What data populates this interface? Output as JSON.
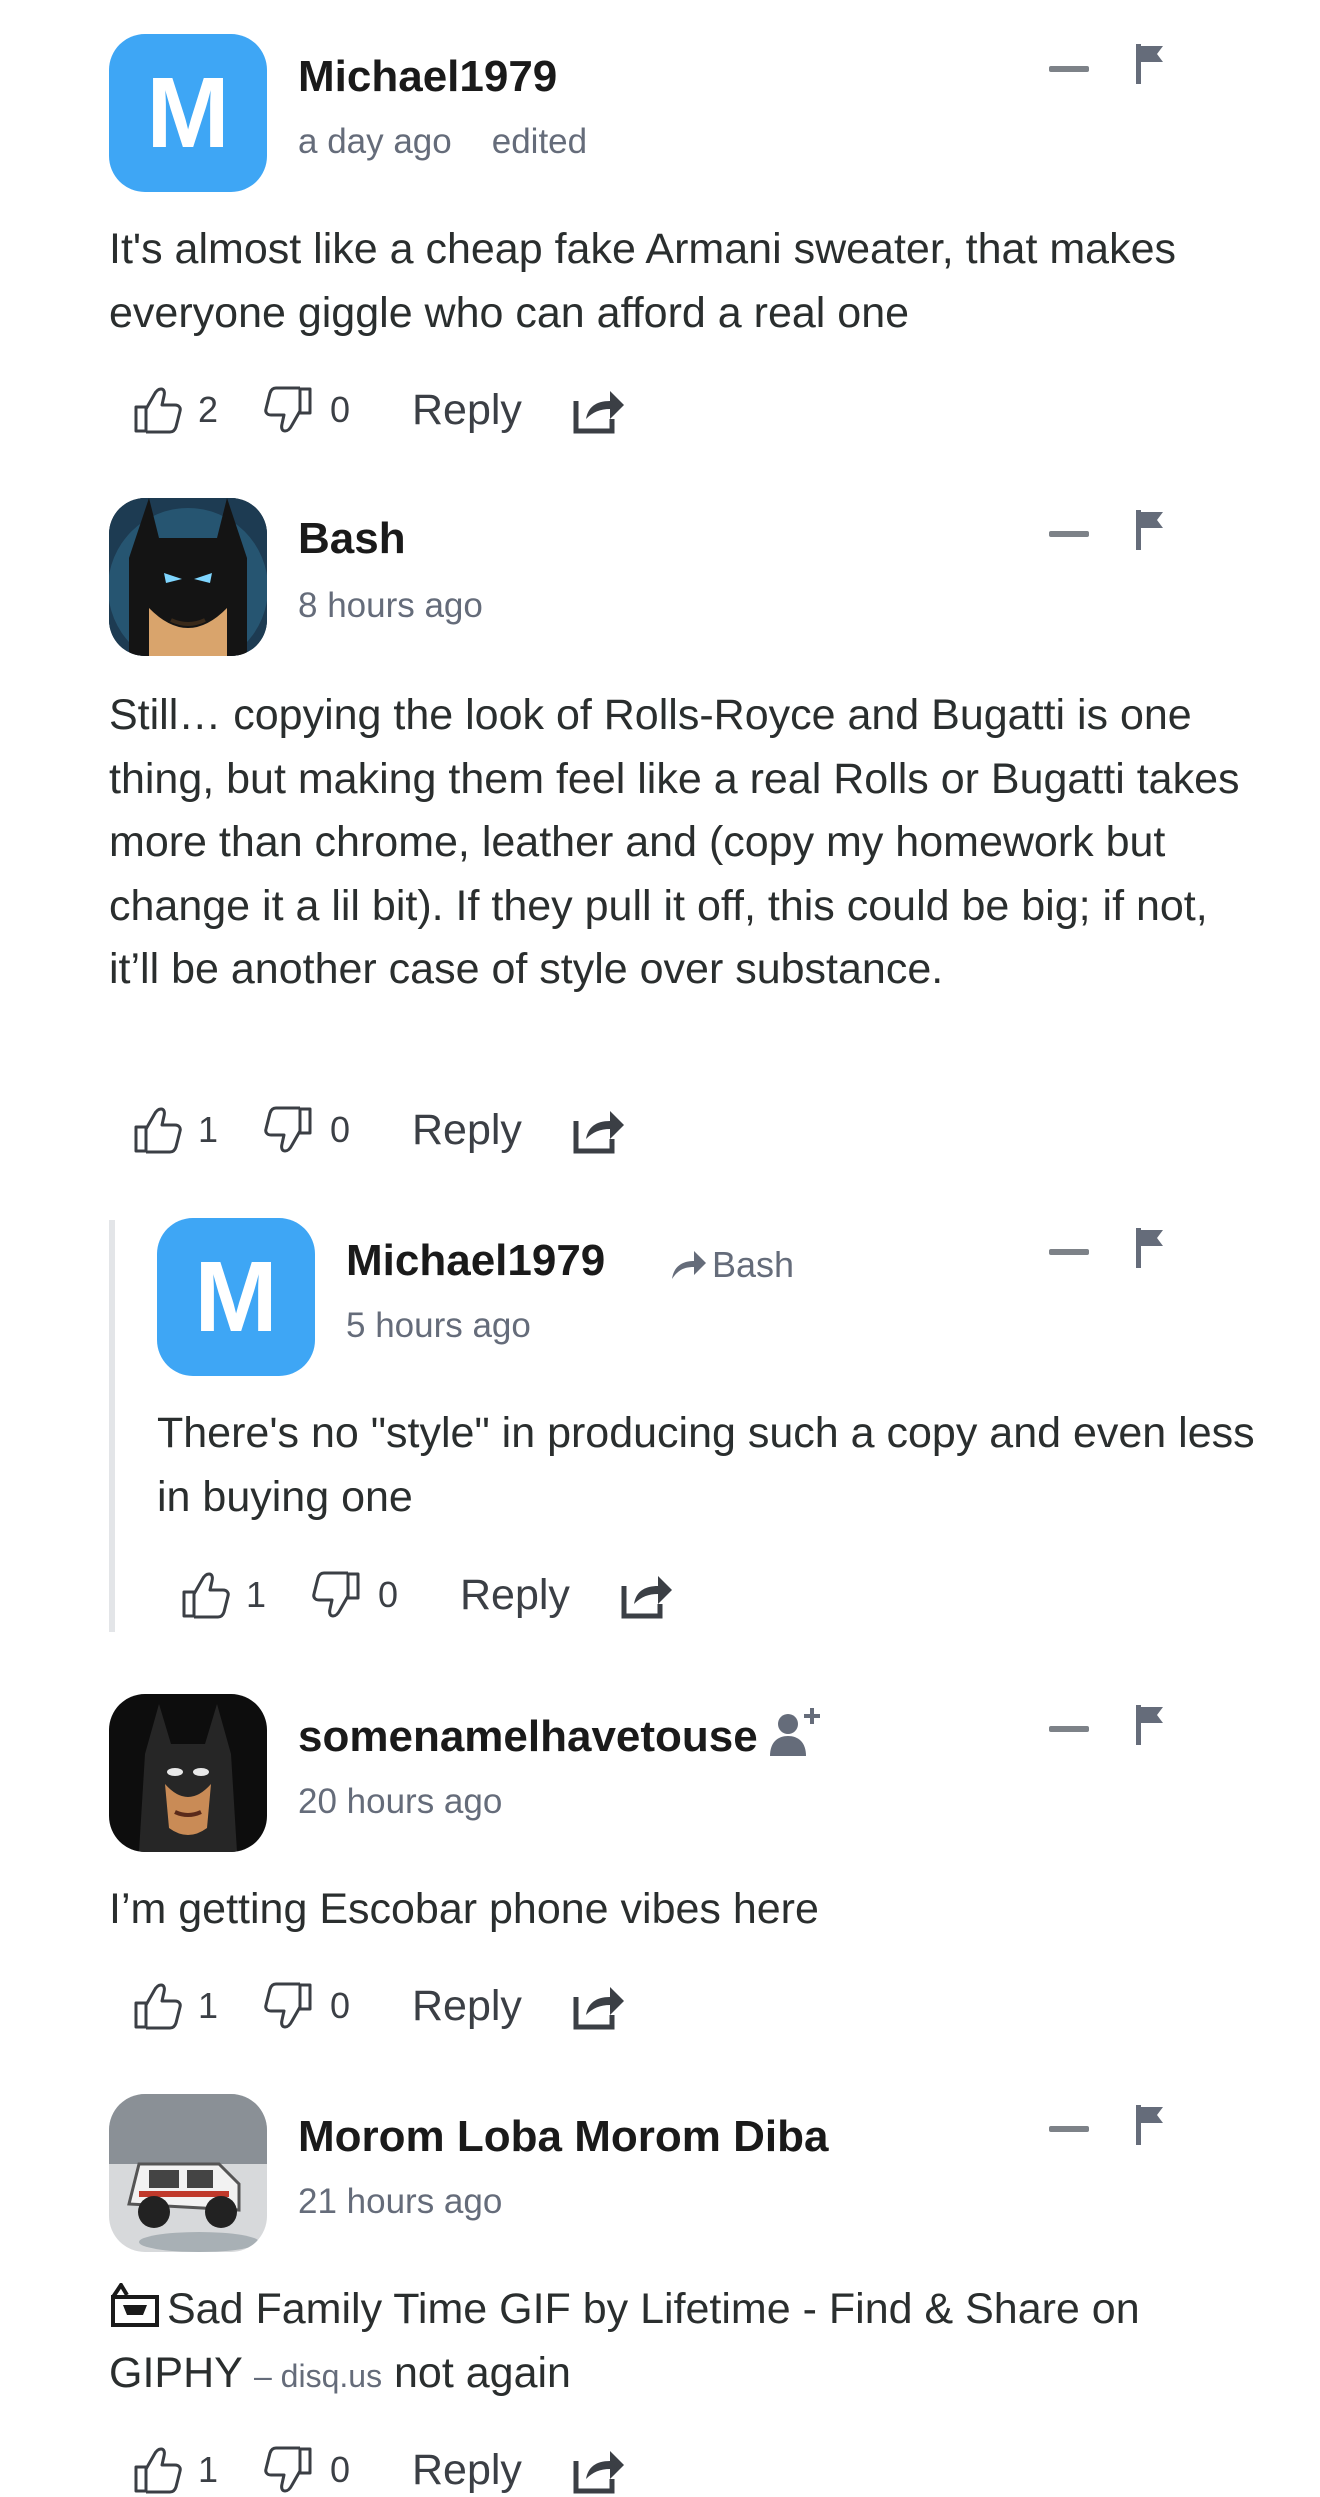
{
  "colors": {
    "accent": "#3ea6f5",
    "text": "#2a2e2e",
    "muted": "#656c7a"
  },
  "comments": [
    {
      "author": "Michael1979",
      "avatar_letter": "M",
      "time": "a day ago",
      "edited": "edited",
      "body": "It's almost like a cheap fake Armani sweater, that makes everyone giggle who can afford a real one",
      "likes": "2",
      "dislikes": "0",
      "reply_label": "Reply"
    },
    {
      "author": "Bash",
      "time": "8 hours ago",
      "body": "Still… copying the look of Rolls-Royce and Bugatti is one thing, but making them feel like a real Rolls or Bugatti takes more than chrome, leather and (copy my homework but change it a lil bit). If they pull it off, this could be big; if not, it’ll be another case of style over substance.",
      "likes": "1",
      "dislikes": "0",
      "reply_label": "Reply"
    },
    {
      "author": "Michael1979",
      "avatar_letter": "M",
      "reply_to": "Bash",
      "time": "5 hours ago",
      "body": "There's no \"style\" in producing such a copy and even less in buying one",
      "likes": "1",
      "dislikes": "0",
      "reply_label": "Reply"
    },
    {
      "author": "somenamelhavetouse",
      "time": "20 hours ago",
      "body": "I’m getting Escobar phone vibes here",
      "likes": "1",
      "dislikes": "0",
      "reply_label": "Reply"
    },
    {
      "author": "Morom Loba Morom Diba",
      "time": "21 hours ago",
      "body_link": "Sad Family Time GIF by Lifetime - Find & Share on GIPHY",
      "body_via": "– disq.us",
      "body_tail": "not again",
      "likes": "1",
      "dislikes": "0",
      "reply_label": "Reply"
    }
  ]
}
